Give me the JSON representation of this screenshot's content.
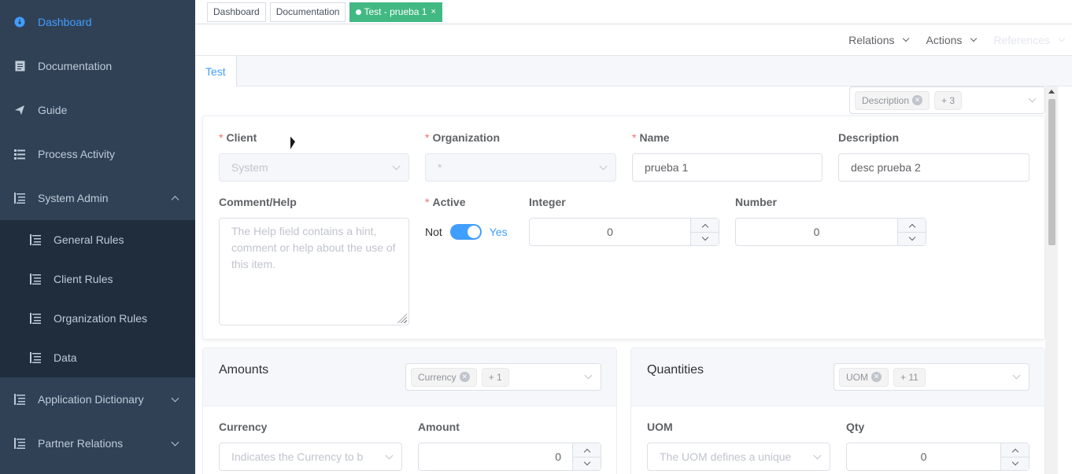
{
  "sidebar": {
    "items": [
      {
        "label": "Dashboard",
        "icon": "dashboard-icon"
      },
      {
        "label": "Documentation",
        "icon": "document-icon"
      },
      {
        "label": "Guide",
        "icon": "send-icon"
      },
      {
        "label": "Process Activity",
        "icon": "list-icon"
      },
      {
        "label": "System Admin",
        "icon": "tree-icon"
      }
    ],
    "system_admin_children": [
      {
        "label": "General Rules"
      },
      {
        "label": "Client Rules"
      },
      {
        "label": "Organization Rules"
      },
      {
        "label": "Data"
      }
    ],
    "bottom_items": [
      {
        "label": "Application Dictionary"
      },
      {
        "label": "Partner Relations"
      }
    ]
  },
  "tags": {
    "dashboard": "Dashboard",
    "documentation": "Documentation",
    "active": "Test - prueba 1",
    "close": "×"
  },
  "toolbar": {
    "relations": "Relations",
    "actions": "Actions",
    "references": "References"
  },
  "tabs": {
    "test": "Test"
  },
  "field_filter": {
    "chip": "Description",
    "more": "+ 3"
  },
  "form": {
    "client": {
      "label": "Client",
      "value": "System"
    },
    "organization": {
      "label": "Organization",
      "value": "*"
    },
    "name": {
      "label": "Name",
      "value": "prueba 1"
    },
    "description": {
      "label": "Description",
      "value": "desc prueba 2"
    },
    "comment_help": {
      "label": "Comment/Help",
      "placeholder": "The Help field contains a hint, comment or help about the use of this item."
    },
    "active": {
      "label": "Active",
      "off": "Not",
      "on": "Yes"
    },
    "integer": {
      "label": "Integer",
      "value": "0"
    },
    "number": {
      "label": "Number",
      "value": "0"
    }
  },
  "amounts": {
    "title": "Amounts",
    "chip": "Currency",
    "more": "+ 1",
    "currency": {
      "label": "Currency",
      "placeholder": "Indicates the Currency to b"
    },
    "amount": {
      "label": "Amount",
      "value": "0"
    }
  },
  "quantities": {
    "title": "Quantities",
    "chip": "UOM",
    "more": "+ 11",
    "uom": {
      "label": "UOM",
      "placeholder": "The UOM defines a unique"
    },
    "qty": {
      "label": "Qty",
      "value": "0"
    }
  },
  "colors": {
    "sidebar_bg": "#304156",
    "submenu_bg": "#1f2d3d",
    "accent": "#409eff",
    "active_tag": "#42b983"
  }
}
